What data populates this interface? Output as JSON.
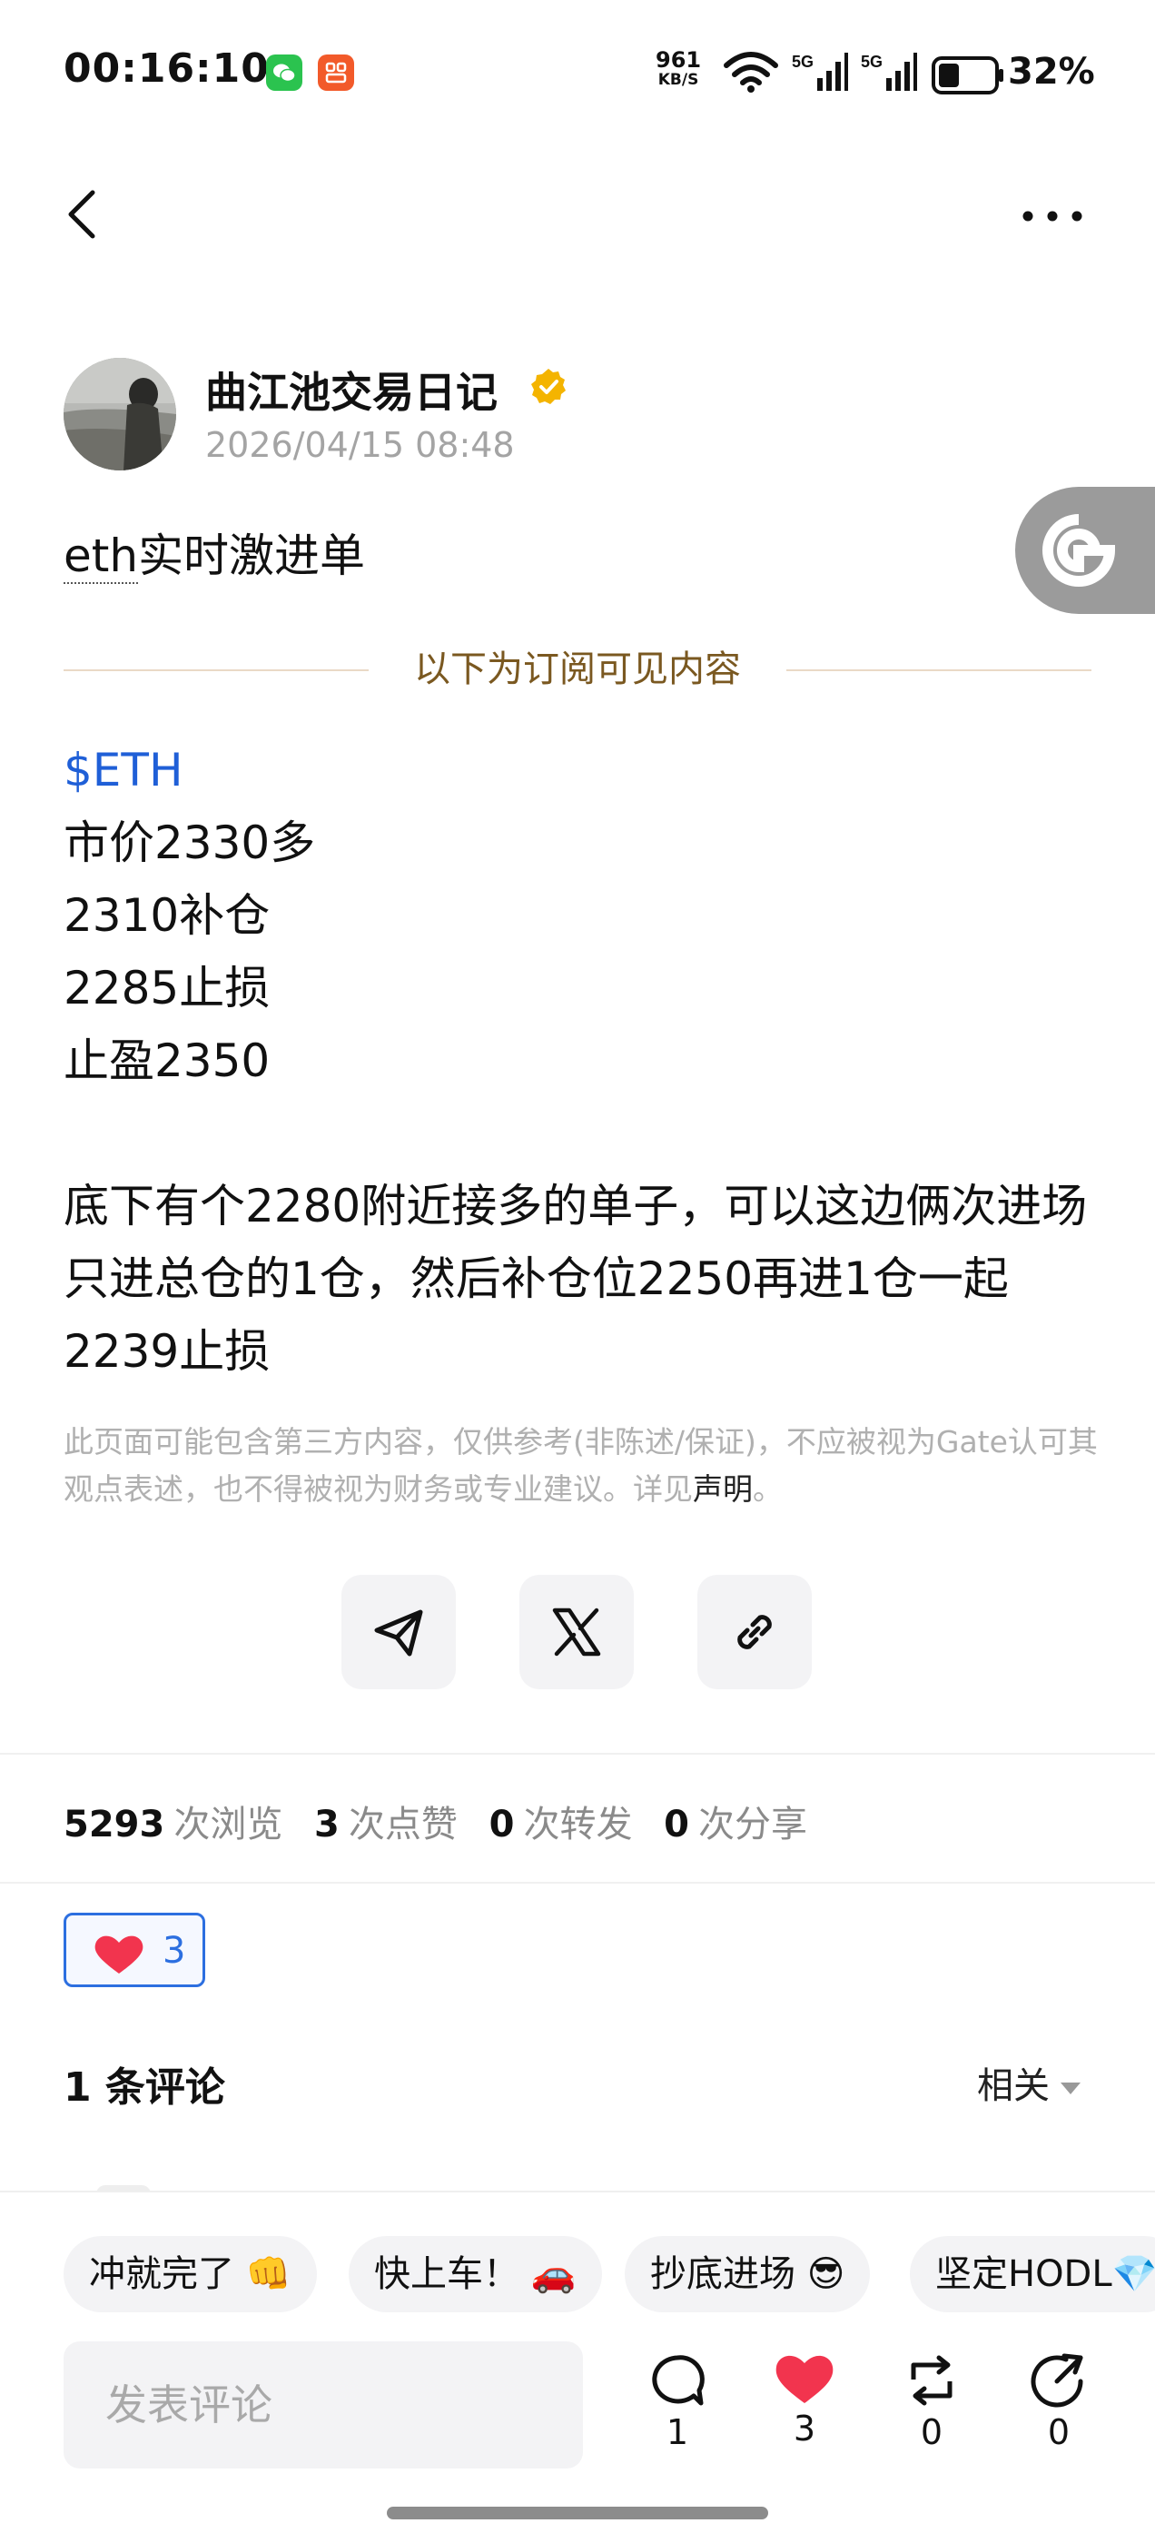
{
  "status_bar": {
    "time": "00:16:10",
    "net_speed": "961",
    "net_speed_unit": "KB/S",
    "battery": "32%",
    "icons": [
      "wechat-icon",
      "app-notification-icon",
      "wifi-icon",
      "5g-signal-icon",
      "5g-signal-icon",
      "battery-icon"
    ]
  },
  "nav": {
    "back_icon": "chevron-left-icon",
    "more_icon": "more-dots-icon"
  },
  "author": {
    "name": "曲江池交易日记",
    "timestamp": "2026/04/15 08:48",
    "verified_icon": "verified-badge-icon"
  },
  "post": {
    "title_tag": "eth",
    "title_rest": "实时激进单",
    "subscription_divider": "以下为订阅可见内容",
    "ticker": "$ETH",
    "lines": [
      "市价2330多",
      "2310补仓",
      "2285止损",
      "止盈2350"
    ],
    "paragraph": "底下有个2280附近接多的单子，可以这边俩次进场只进总仓的1仓，然后补仓位2250再进1仓一起2239止损",
    "disclaimer": "此页面可能包含第三方内容，仅供参考(非陈述/保证)，不应被视为Gate认可其观点表述，也不得被视为财务或专业建议。详见",
    "disclaimer_link": "声明",
    "disclaimer_end": "。"
  },
  "share": {
    "icons": [
      "telegram-icon",
      "x-icon",
      "link-icon"
    ]
  },
  "stats": {
    "views": "5293",
    "views_label": "次浏览",
    "likes": "3",
    "likes_label": "次点赞",
    "reposts": "0",
    "reposts_label": "次转发",
    "shares": "0",
    "shares_label": "次分享"
  },
  "reaction": {
    "count": "3",
    "color": "#2c6fe0"
  },
  "comments": {
    "title": "1 条评论",
    "sort": "相关"
  },
  "quick_replies": [
    "冲就完了 👊",
    "快上车！ 🚗",
    "抄底进场 😎",
    "坚定HODL💎"
  ],
  "composer": {
    "placeholder": "发表评论",
    "comment_count": "1",
    "like_count": "3",
    "repost_count": "0",
    "share_count": "0"
  },
  "colors": {
    "accent_link": "#1f5fd7",
    "heart": "#f2344e",
    "verified": "#f4b400",
    "subscription_text": "#7a5820"
  }
}
